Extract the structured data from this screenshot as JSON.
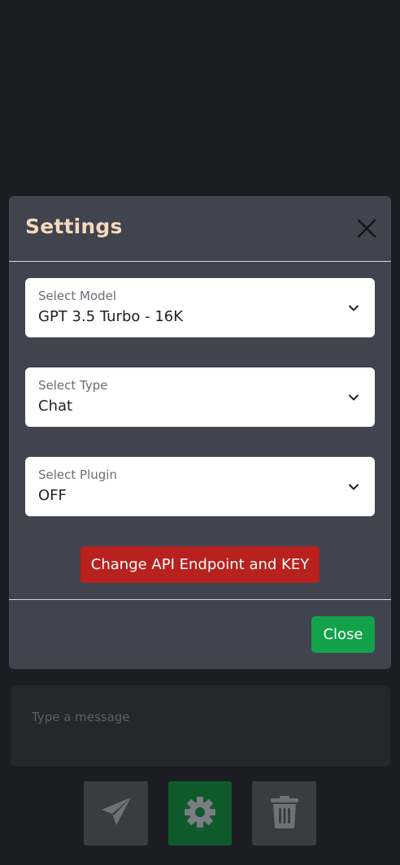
{
  "modal": {
    "title": "Settings",
    "fields": [
      {
        "label": "Select Model",
        "value": "GPT 3.5 Turbo - 16K"
      },
      {
        "label": "Select Type",
        "value": "Chat"
      },
      {
        "label": "Select Plugin",
        "value": "OFF"
      }
    ],
    "api_button_label": "Change API Endpoint and KEY",
    "close_button_label": "Close"
  },
  "composer": {
    "placeholder": "Type a message"
  },
  "actions": {
    "send_icon": "paper-plane-icon",
    "settings_icon": "gear-icon",
    "delete_icon": "trash-icon"
  },
  "colors": {
    "title": "#f5d9bd",
    "danger": "#b8211e",
    "success": "#12a24a",
    "settings_active": "#0f5a2a"
  }
}
